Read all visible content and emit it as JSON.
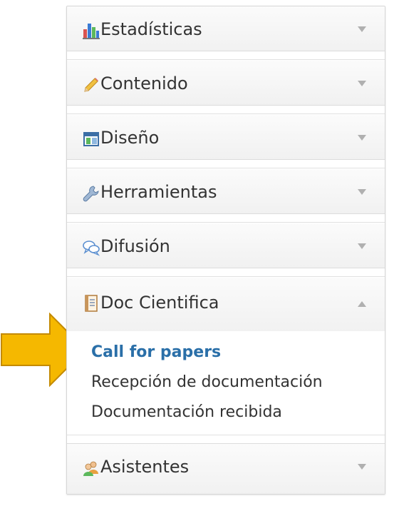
{
  "menu": {
    "sections": [
      {
        "label": "Estadísticas",
        "icon": "bar-chart-icon",
        "state": "collapsed"
      },
      {
        "label": "Contenido",
        "icon": "pencil-icon",
        "state": "collapsed"
      },
      {
        "label": "Diseño",
        "icon": "layout-icon",
        "state": "collapsed"
      },
      {
        "label": "Herramientas",
        "icon": "wrench-icon",
        "state": "collapsed"
      },
      {
        "label": "Difusión",
        "icon": "speech-bubbles-icon",
        "state": "collapsed"
      },
      {
        "label": "Doc Cientifica",
        "icon": "document-icon",
        "state": "expanded"
      },
      {
        "label": "Asistentes",
        "icon": "users-icon",
        "state": "collapsed"
      }
    ],
    "doc_cientifica_items": [
      {
        "label": "Call for papers",
        "active": true
      },
      {
        "label": "Recepción de documentación",
        "active": false
      },
      {
        "label": "Documentación recibida",
        "active": false
      }
    ]
  },
  "colors": {
    "active_link": "#2a6fa8",
    "pointer_arrow": "#f5b800"
  }
}
